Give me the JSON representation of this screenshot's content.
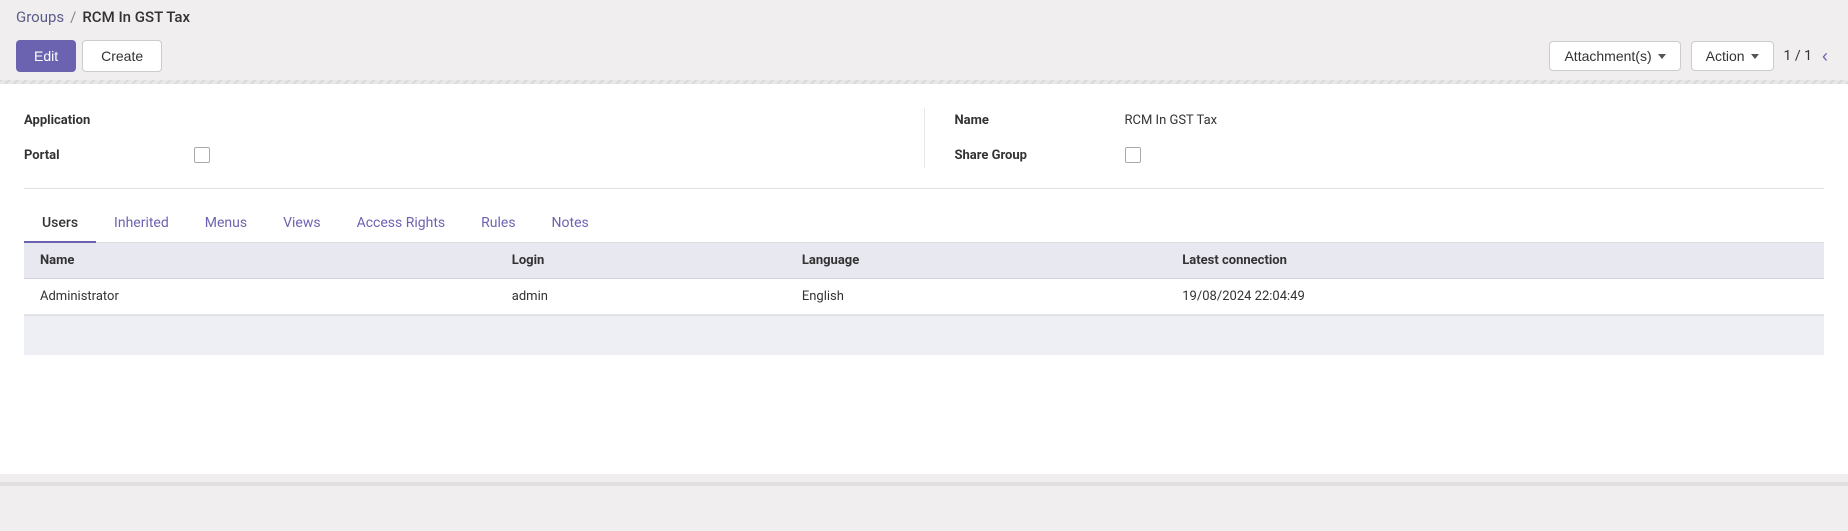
{
  "breadcrumb": {
    "parent_label": "Groups",
    "separator": "/",
    "current_label": "RCM In GST Tax"
  },
  "toolbar": {
    "edit_label": "Edit",
    "create_label": "Create",
    "attachments_label": "Attachment(s)",
    "action_label": "Action",
    "pagination": "1 / 1"
  },
  "form": {
    "left": {
      "application_label": "Application",
      "application_value": "",
      "portal_label": "Portal",
      "portal_checked": false
    },
    "right": {
      "name_label": "Name",
      "name_value": "RCM In GST Tax",
      "share_group_label": "Share Group",
      "share_group_checked": false
    }
  },
  "tabs": [
    {
      "id": "users",
      "label": "Users",
      "active": true
    },
    {
      "id": "inherited",
      "label": "Inherited",
      "active": false
    },
    {
      "id": "menus",
      "label": "Menus",
      "active": false
    },
    {
      "id": "views",
      "label": "Views",
      "active": false
    },
    {
      "id": "access-rights",
      "label": "Access Rights",
      "active": false
    },
    {
      "id": "rules",
      "label": "Rules",
      "active": false
    },
    {
      "id": "notes",
      "label": "Notes",
      "active": false
    }
  ],
  "table": {
    "columns": [
      {
        "id": "name",
        "label": "Name"
      },
      {
        "id": "login",
        "label": "Login"
      },
      {
        "id": "language",
        "label": "Language"
      },
      {
        "id": "latest_connection",
        "label": "Latest connection"
      }
    ],
    "rows": [
      {
        "name": "Administrator",
        "login": "admin",
        "language": "English",
        "latest_connection": "19/08/2024 22:04:49"
      }
    ]
  }
}
